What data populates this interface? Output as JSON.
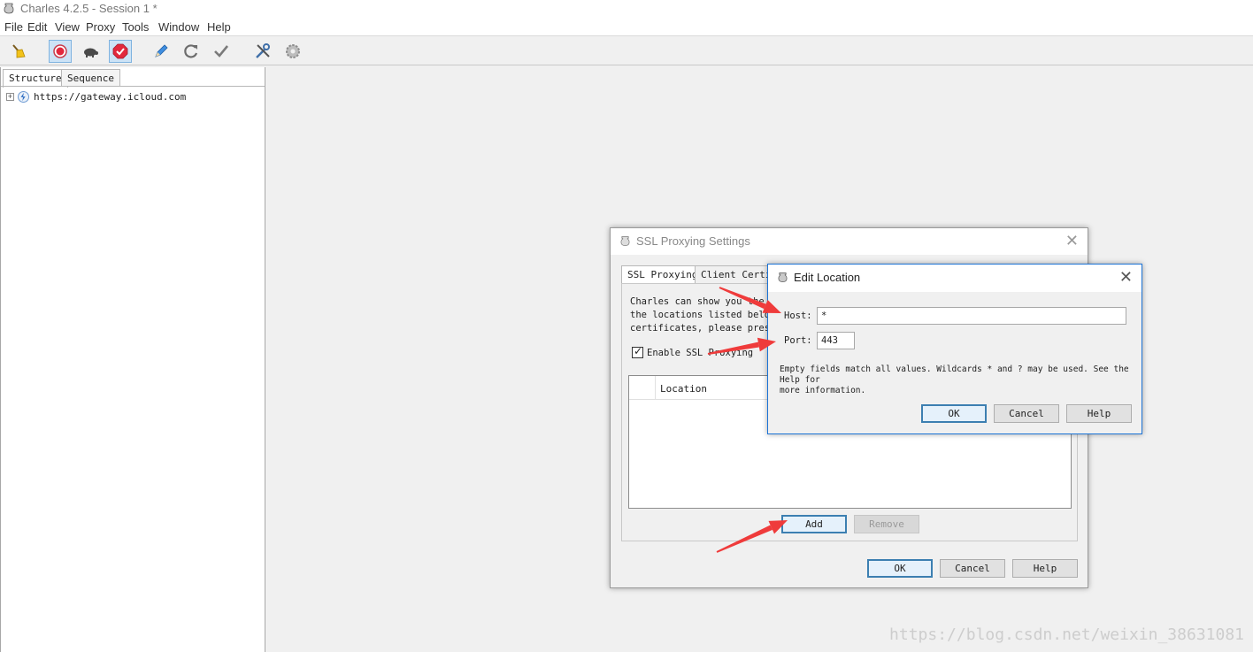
{
  "window": {
    "title": "Charles 4.2.5 - Session 1 *"
  },
  "menu": [
    "File",
    "Edit",
    "View",
    "Proxy",
    "Tools",
    "Window",
    "Help"
  ],
  "toolbar": {
    "icons": [
      "broom-icon",
      "record-icon",
      "throttle-turtle-icon",
      "breakpoints-icon",
      "compose-pen-icon",
      "repeat-icon",
      "validate-check-icon",
      "tools-icon",
      "settings-gear-icon"
    ],
    "toggled": [
      "record-icon",
      "breakpoints-icon"
    ]
  },
  "left_panel": {
    "tabs": [
      "Structure",
      "Sequence"
    ],
    "active_tab": "Structure",
    "tree": [
      {
        "expander": "+",
        "label": "https://gateway.icloud.com"
      }
    ]
  },
  "ssl_dialog": {
    "title": "SSL Proxying Settings",
    "tabs": [
      "SSL Proxying",
      "Client Certif"
    ],
    "description_lines": [
      "Charles can show you the p",
      "the locations listed below",
      "certificates, please press"
    ],
    "enable_label": "Enable SSL Proxying",
    "enable_checked": true,
    "table_header": "Location",
    "buttons": {
      "add": "Add",
      "remove": "Remove"
    },
    "footer_buttons": {
      "ok": "OK",
      "cancel": "Cancel",
      "help": "Help"
    }
  },
  "edit_dialog": {
    "title": "Edit Location",
    "host_label": "Host:",
    "host_value": "*",
    "port_label": "Port:",
    "port_value": "443",
    "help_text_1": "Empty fields match all values. Wildcards * and ? may be used. See the Help for",
    "help_text_2": "more information.",
    "buttons": {
      "ok": "OK",
      "cancel": "Cancel",
      "help": "Help"
    }
  },
  "annotations": {
    "arrow_color": "#ef3b3b"
  },
  "watermark": "https://blog.csdn.net/weixin_38631081"
}
